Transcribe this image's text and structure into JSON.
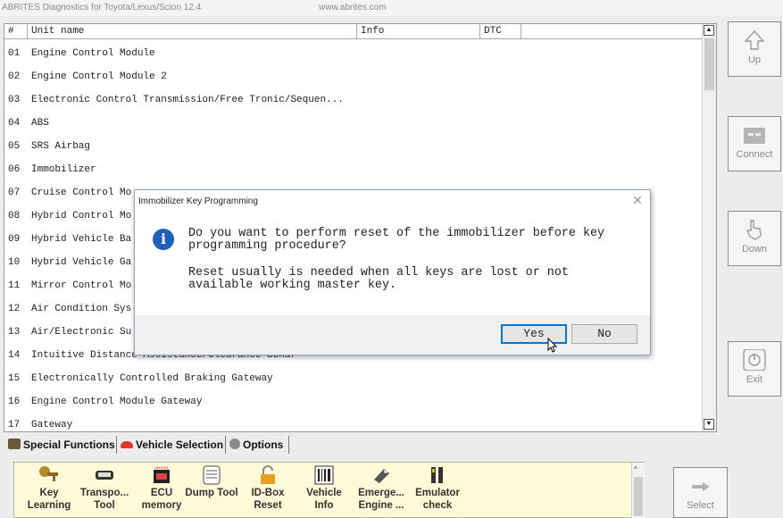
{
  "window": {
    "title": "ABRITES Diagnostics for Toyota/Lexus/Scion 12.4",
    "url": "www.abrites.com"
  },
  "table": {
    "headers": {
      "num": "#",
      "unit": "Unit name",
      "info": "Info",
      "dtc": "DTC"
    },
    "rows": [
      {
        "num": "01",
        "name": "Engine Control Module"
      },
      {
        "num": "02",
        "name": "Engine Control Module 2"
      },
      {
        "num": "03",
        "name": "Electronic Control Transmission/Free Tronic/Sequen..."
      },
      {
        "num": "04",
        "name": "ABS"
      },
      {
        "num": "05",
        "name": "SRS Airbag"
      },
      {
        "num": "06",
        "name": "Immobilizer"
      },
      {
        "num": "07",
        "name": "Cruise Control Mo"
      },
      {
        "num": "08",
        "name": "Hybrid Control Mo"
      },
      {
        "num": "09",
        "name": "Hybrid Vehicle Ba"
      },
      {
        "num": "10",
        "name": "Hybrid Vehicle Ga"
      },
      {
        "num": "11",
        "name": "Mirror Control Mo"
      },
      {
        "num": "12",
        "name": "Air Condition Sys"
      },
      {
        "num": "13",
        "name": "Air/Electronic Su"
      },
      {
        "num": "14",
        "name": "Intuitive Distance Assistance/Clearance Sonar"
      },
      {
        "num": "15",
        "name": "Electronically Controlled Braking Gateway"
      },
      {
        "num": "16",
        "name": "Engine Control Module Gateway"
      },
      {
        "num": "17",
        "name": "Gateway"
      }
    ]
  },
  "side_buttons": {
    "up": "Up",
    "connect": "Connect",
    "down": "Down",
    "exit": "Exit",
    "select": "Select"
  },
  "tabs": {
    "special": "Special Functions",
    "vehicle": "Vehicle Selection",
    "options": "Options"
  },
  "functions": [
    {
      "line1": "Key",
      "line2": "Learning",
      "icon": "key-icon"
    },
    {
      "line1": "Transpo...",
      "line2": "Tool",
      "icon": "transponder-icon"
    },
    {
      "line1": "ECU",
      "line2": "memory",
      "icon": "ecu-chip-icon"
    },
    {
      "line1": "Dump Tool",
      "line2": "",
      "icon": "dump-icon"
    },
    {
      "line1": "ID-Box",
      "line2": "Reset",
      "icon": "lock-icon"
    },
    {
      "line1": "Vehicle",
      "line2": "Info",
      "icon": "barcode-icon"
    },
    {
      "line1": "Emerge...",
      "line2": "Engine ...",
      "icon": "emergency-key-icon"
    },
    {
      "line1": "Emulator",
      "line2": "check",
      "icon": "emulator-icon"
    }
  ],
  "dialog": {
    "title": "Immobilizer Key Programming",
    "message_line1": "Do you want to perform reset of the immobilizer before key",
    "message_line2": "programming procedure?",
    "message_line3": "Reset usually is needed when all keys are lost or not",
    "message_line4": "available working master key.",
    "yes": "Yes",
    "no": "No"
  },
  "colors": {
    "dialog_info": "#1e60b6",
    "function_panel_bg": "#fdfbd7",
    "default_button_border": "#0078d7"
  }
}
